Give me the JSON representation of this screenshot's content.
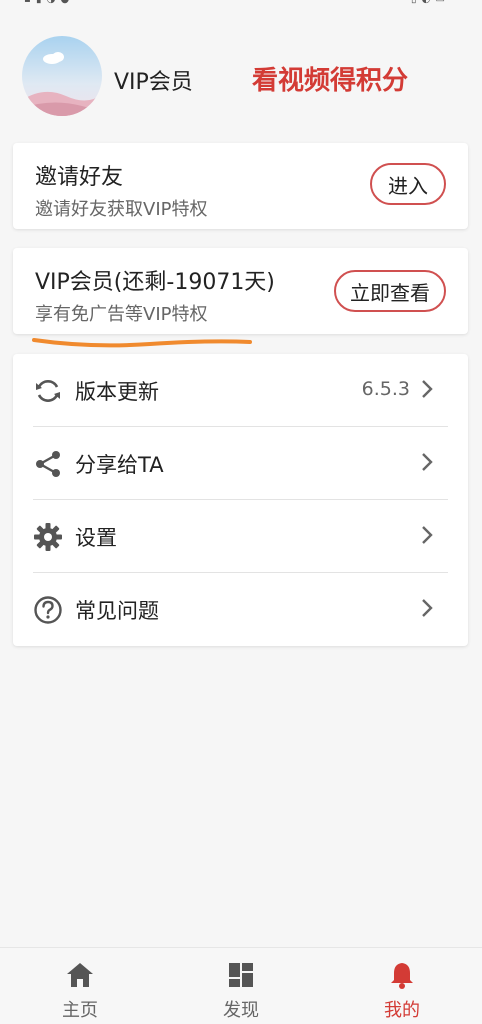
{
  "header": {
    "username": "VIP会员",
    "points_link": "看视频得积分"
  },
  "invite_card": {
    "title": "邀请好友",
    "subtitle": "邀请好友获取VIP特权",
    "button": "进入"
  },
  "vip_card": {
    "title": "VIP会员(还剩-19071天)",
    "subtitle": "享有免广告等VIP特权",
    "button": "立即查看"
  },
  "menu": {
    "items": [
      {
        "label": "版本更新",
        "value": "6.5.3",
        "icon": "refresh-icon"
      },
      {
        "label": "分享给TA",
        "value": "",
        "icon": "share-icon"
      },
      {
        "label": "设置",
        "value": "",
        "icon": "gear-icon"
      },
      {
        "label": "常见问题",
        "value": "",
        "icon": "question-icon"
      }
    ]
  },
  "tabbar": {
    "tabs": [
      {
        "label": "主页",
        "icon": "home-icon",
        "active": false
      },
      {
        "label": "发现",
        "icon": "discover-grid-icon",
        "active": false
      },
      {
        "label": "我的",
        "icon": "bell-icon",
        "active": true
      }
    ]
  },
  "colors": {
    "accent": "#d33b35",
    "button_border": "#d05050",
    "highlight_mark": "#f08a2e",
    "background": "#f6f6f6"
  }
}
